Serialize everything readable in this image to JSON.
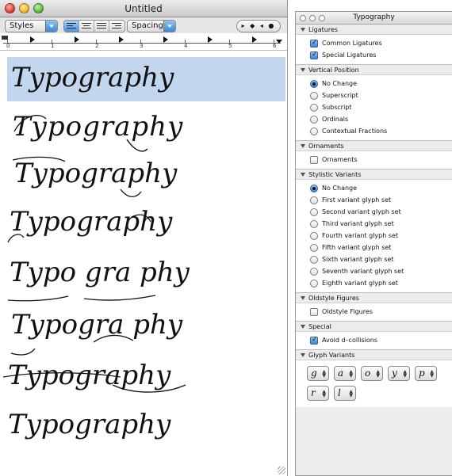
{
  "window": {
    "title": "Untitled",
    "toolbar": {
      "styles_label": "Styles",
      "spacing_label": "Spacing",
      "tab_buttons": "▸ ◆ ◂ ●"
    },
    "ruler_numbers": [
      "0",
      "1",
      "2",
      "3",
      "4",
      "5",
      "6"
    ]
  },
  "document": {
    "samples": [
      {
        "text": "Typography",
        "variant": "default",
        "selected": true
      },
      {
        "text": "Typography",
        "variant": "swash-1"
      },
      {
        "text": "Typography",
        "variant": "swash-2"
      },
      {
        "text": "Typography",
        "variant": "swash-3"
      },
      {
        "text": "Typo gra phy",
        "variant": "swash-4"
      },
      {
        "text": "Typogra phy",
        "variant": "swash-5"
      },
      {
        "text": "Typography",
        "variant": "swash-6"
      },
      {
        "text": "Typography",
        "variant": "swash-7"
      }
    ]
  },
  "palette": {
    "title": "Typography",
    "ligatures": {
      "heading": "Ligatures",
      "common": {
        "label": "Common Ligatures",
        "checked": true
      },
      "special": {
        "label": "Special Ligatures",
        "checked": true
      }
    },
    "vertical_position": {
      "heading": "Vertical Position",
      "options": [
        "No Change",
        "Superscript",
        "Subscript",
        "Ordinals",
        "Contextual Fractions"
      ],
      "selected": "No Change"
    },
    "ornaments": {
      "heading": "Ornaments",
      "item": {
        "label": "Ornaments",
        "checked": false
      }
    },
    "stylistic_variants": {
      "heading": "Stylistic Variants",
      "options": [
        "No Change",
        "First variant glyph set",
        "Second variant glyph set",
        "Third variant glyph set",
        "Fourth variant glyph set",
        "Fifth variant glyph set",
        "Sixth variant glyph set",
        "Seventh variant glyph set",
        "Eighth variant glyph set"
      ],
      "selected": "No Change"
    },
    "oldstyle_figures": {
      "heading": "Oldstyle Figures",
      "item": {
        "label": "Oldstyle Figures",
        "checked": false
      }
    },
    "special": {
      "heading": "Special",
      "item": {
        "label": "Avoid d–collisions",
        "checked": true
      }
    },
    "glyph_variants": {
      "heading": "Glyph Variants",
      "glyphs": [
        "g",
        "a",
        "o",
        "y",
        "p",
        "r",
        "l"
      ]
    }
  },
  "colors": {
    "selection": "#c2d6ee",
    "accent": "#3a84d8"
  }
}
